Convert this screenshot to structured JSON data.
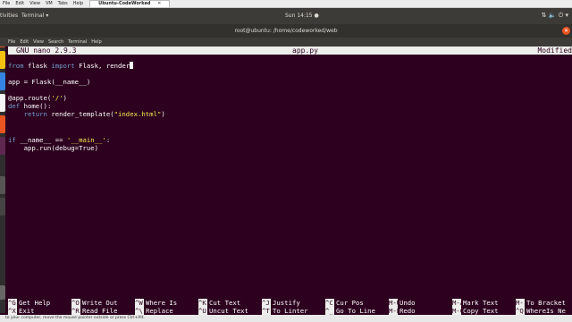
{
  "vbox": {
    "menu": [
      "File",
      "Edit",
      "View",
      "VM",
      "Tabs",
      "Help"
    ],
    "vm_tab": "Ubuntu-CodeWorked"
  },
  "panel": {
    "activities": "tivities",
    "app": "Terminal ▾",
    "clock": "Sun 14:15 ●"
  },
  "terminal": {
    "title": "root@ubuntu: /home/codeworked/web",
    "menu": [
      "File",
      "Edit",
      "View",
      "Search",
      "Terminal",
      "Help"
    ]
  },
  "nano": {
    "version": "GNU nano 2.9.3",
    "filename": "app.py",
    "status": "Modified"
  },
  "code": {
    "l1_kw1": "from",
    "l1_mid": " flask ",
    "l1_kw2": "import",
    "l1_rest": " Flask, render",
    "l2": "app = Flask(__name__)",
    "l3a": "@app.route(",
    "l3s": "'/'",
    "l3b": ")",
    "l4_kw": "def",
    "l4_rest": " home():",
    "l5_pre": "    ",
    "l5_kw": "return",
    "l5_mid": " render_template(",
    "l5_s": "\"index.html\"",
    "l5_end": ")",
    "l6_kw": "if",
    "l6_mid": " __name__ == ",
    "l6_s": "'__main__'",
    "l6_end": ":",
    "l7": "    app.run(debug=True)"
  },
  "shortcuts": [
    {
      "key": "^G",
      "label": "Get Help"
    },
    {
      "key": "^O",
      "label": "Write Out"
    },
    {
      "key": "^W",
      "label": "Where Is"
    },
    {
      "key": "^K",
      "label": "Cut Text"
    },
    {
      "key": "^J",
      "label": "Justify"
    },
    {
      "key": "^C",
      "label": "Cur Pos"
    },
    {
      "key": "M-U",
      "label": "Undo"
    },
    {
      "key": "M-A",
      "label": "Mark Text"
    },
    {
      "key": "M-]",
      "label": "To Bracket"
    },
    {
      "key": "^X",
      "label": "Exit"
    },
    {
      "key": "^R",
      "label": "Read File"
    },
    {
      "key": "^\\",
      "label": "Replace"
    },
    {
      "key": "^U",
      "label": "Uncut Text"
    },
    {
      "key": "^T",
      "label": "To Linter"
    },
    {
      "key": "^_",
      "label": "Go To Line"
    },
    {
      "key": "M-E",
      "label": "Redo"
    },
    {
      "key": "M-6",
      "label": "Copy Text"
    },
    {
      "key": "^Q",
      "label": "WhereIs Ne"
    }
  ],
  "statusbar": "to your computer, move the mouse pointer outside or press Ctrl+Alt.",
  "colors": {
    "terminal_bg": "#2c001e",
    "header_bg": "#eeeeec",
    "keyword": "#729fcf",
    "string": "#fce94f",
    "launcher_accent": "#e95420"
  }
}
